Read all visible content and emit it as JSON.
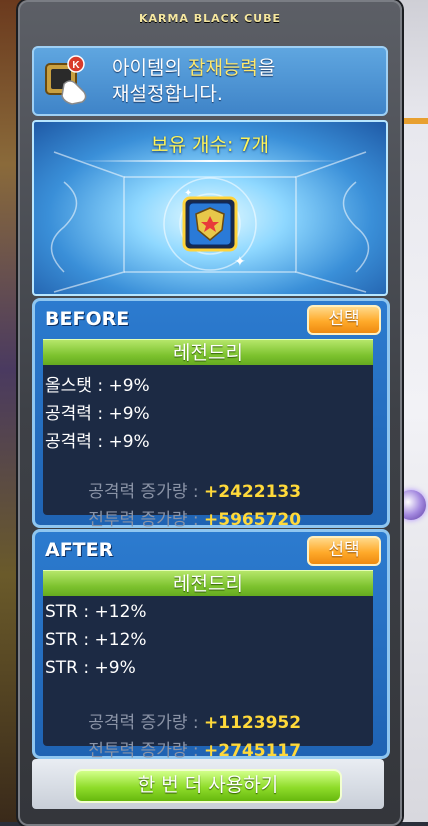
{
  "window": {
    "title": "KARMA BLACK CUBE"
  },
  "info": {
    "line1_prefix": "아이템의 ",
    "line1_highlight": "잠재능력",
    "line1_suffix": "을",
    "line2": "재설정합니다."
  },
  "cube": {
    "count_text": "보유 개수: 7개"
  },
  "before": {
    "label": "BEFORE",
    "select_label": "선택",
    "grade": "레전드리",
    "lines": [
      "올스탯 : +9%",
      "공격력 : +9%",
      "공격력 : +9%"
    ],
    "attack_increase_label": "공격력 증가량 : ",
    "attack_increase_value": "+2422133",
    "power_increase_label": "전투력 증가량 : ",
    "power_increase_value": "+5965720"
  },
  "after": {
    "label": "AFTER",
    "select_label": "선택",
    "grade": "레전드리",
    "lines": [
      "STR : +12%",
      "STR : +12%",
      "STR : +9%"
    ],
    "attack_increase_label": "공격력 증가량 : ",
    "attack_increase_value": "+1123952",
    "power_increase_label": "전투력 증가량 : ",
    "power_increase_value": "+2745117"
  },
  "reuse_button": {
    "label": "한 번 더 사용하기"
  },
  "colors": {
    "grade_legendary": "#7cc22e",
    "increase_value": "#ffd93a",
    "select_button": "#ffaa2a"
  }
}
